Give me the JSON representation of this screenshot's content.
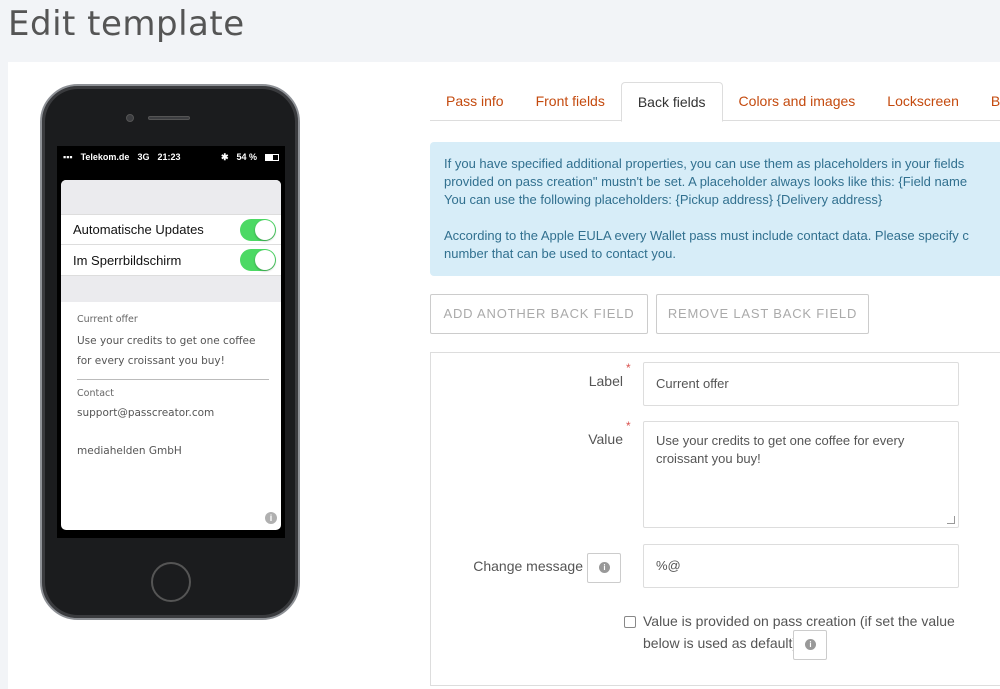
{
  "page": {
    "title": "Edit template"
  },
  "phone": {
    "status": {
      "carrier": "Telekom.de",
      "network": "3G",
      "time": "21:23",
      "battery": "54 %"
    },
    "toggles": [
      {
        "label": "Automatische Updates"
      },
      {
        "label": "Im Sperrbildschirm"
      }
    ],
    "fields": [
      {
        "label": "Current offer",
        "value": "Use your credits to get one coffee for every croissant you buy!"
      },
      {
        "label": "Contact",
        "value": "support@passcreator.com"
      }
    ],
    "company": "mediahelden GmbH"
  },
  "tabs": [
    {
      "label": "Pass info"
    },
    {
      "label": "Front fields"
    },
    {
      "label": "Back fields"
    },
    {
      "label": "Colors and images"
    },
    {
      "label": "Lockscreen"
    },
    {
      "label": "Bea"
    }
  ],
  "alert": {
    "line1": "If you have specified additional properties, you can use them as placeholders in your fields",
    "line2": "provided on pass creation\" mustn't be set. A placeholder always looks like this: {Field name",
    "line3": "You can use the following placeholders: {Pickup address} {Delivery address}",
    "line4": "According to the Apple EULA every Wallet pass must include contact data. Please specify c",
    "line5": "number that can be used to contact you."
  },
  "buttons": {
    "add": "ADD ANOTHER BACK FIELD",
    "remove": "REMOVE LAST BACK FIELD"
  },
  "form": {
    "label_label": "Label",
    "label_value": "Current offer",
    "value_label": "Value",
    "value_value": "Use your credits to get one coffee for every croissant you buy!",
    "change_label": "Change message",
    "change_value": "%@",
    "checkbox_line1": "Value is provided on pass creation (if set the value",
    "checkbox_line2": "below is used as default)"
  },
  "colors": {
    "accent": "#c44a0e",
    "alert_bg": "#d7edf8",
    "alert_text": "#31708f",
    "switch_on": "#4cd964"
  }
}
